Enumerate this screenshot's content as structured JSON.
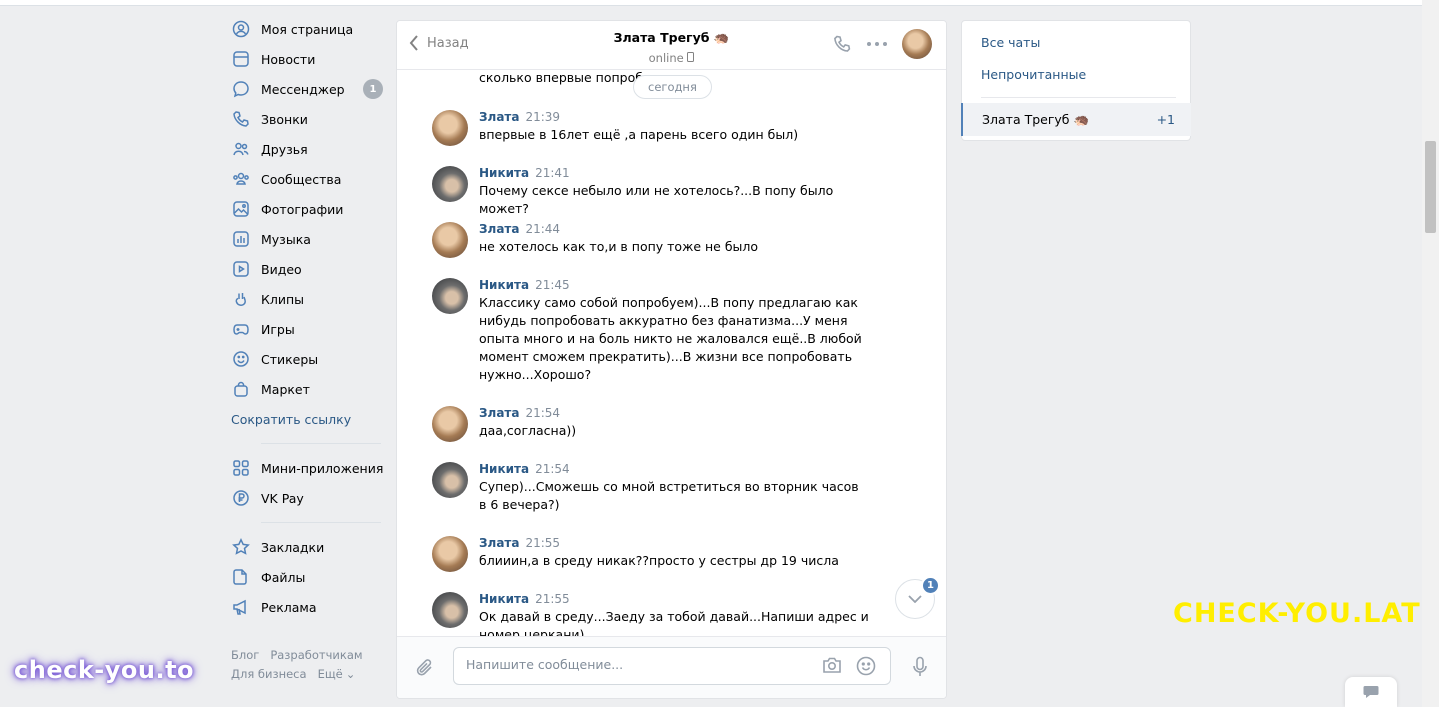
{
  "nav": {
    "items": [
      {
        "label": "Моя страница",
        "icon": "user-circle-icon"
      },
      {
        "label": "Новости",
        "icon": "news-icon"
      },
      {
        "label": "Мессенджер",
        "icon": "message-icon",
        "count": "1"
      },
      {
        "label": "Звонки",
        "icon": "phone-icon"
      },
      {
        "label": "Друзья",
        "icon": "friends-icon"
      },
      {
        "label": "Сообщества",
        "icon": "communities-icon"
      },
      {
        "label": "Фотографии",
        "icon": "photos-icon"
      },
      {
        "label": "Музыка",
        "icon": "music-icon"
      },
      {
        "label": "Видео",
        "icon": "video-icon"
      },
      {
        "label": "Клипы",
        "icon": "clips-icon"
      },
      {
        "label": "Игры",
        "icon": "games-icon"
      },
      {
        "label": "Стикеры",
        "icon": "stickers-icon"
      },
      {
        "label": "Маркет",
        "icon": "market-icon"
      }
    ],
    "shorten_link": "Сократить ссылку",
    "apps": [
      {
        "label": "Мини-приложения",
        "icon": "mini-apps-icon"
      },
      {
        "label": "VK Pay",
        "icon": "vkpay-icon"
      }
    ],
    "extra": [
      {
        "label": "Закладки",
        "icon": "bookmark-icon"
      },
      {
        "label": "Файлы",
        "icon": "files-icon"
      },
      {
        "label": "Реклама",
        "icon": "ads-icon"
      }
    ]
  },
  "footer": {
    "blog": "Блог",
    "developers": "Разработчикам",
    "business": "Для бизнеса",
    "more": "Ещё"
  },
  "chat": {
    "back_label": "Назад",
    "peer_name": "Злата Трегуб",
    "peer_status": "online",
    "date_pill": "сегодня",
    "partial_text": "сколько впервые попробо",
    "messages": [
      {
        "author": "Злата",
        "time": "21:39",
        "text": "впервые в 16лет ещё ,а парень всего один был)"
      },
      {
        "author": "Никита",
        "time": "21:41",
        "text": "Почему сексе небыло или не хотелось?...В попу было может?"
      },
      {
        "author": "Злата",
        "time": "21:44",
        "text": "не хотелось как то,и в попу тоже не было"
      },
      {
        "author": "Никита",
        "time": "21:45",
        "text": "Классику само собой попробуем)...В попу предлагаю как нибудь попробовать аккуратно без фанатизма...У меня опыта много и на боль никто не жаловался ещё..В любой момент сможем прекратить)...В жизни все попробовать нужно...Хорошо?"
      },
      {
        "author": "Злата",
        "time": "21:54",
        "text": "даа,согласна))"
      },
      {
        "author": "Никита",
        "time": "21:54",
        "text": "Супер)...Сможешь со мной встретиться во вторник часов в 6 вечера?)"
      },
      {
        "author": "Злата",
        "time": "21:55",
        "text": "блииин,а в среду никак??просто у сестры др 19 числа"
      },
      {
        "author": "Никита",
        "time": "21:55",
        "text": "Ок давай в среду...Заеду за тобой давай...Напиши адрес и номер церкани)"
      }
    ],
    "unread_badge": "1",
    "composer_placeholder": "Напишите сообщение..."
  },
  "right": {
    "all_chats": "Все чаты",
    "unread": "Непрочитанные",
    "active_chat": "Злата Трегуб",
    "active_count": "+1"
  },
  "watermarks": {
    "left": "check-you.to",
    "right": "CHECK-YOU.LAT"
  },
  "colors": {
    "accent": "#2a5885",
    "badge": "#5181b8",
    "background": "#edeef0",
    "watermark_yellow": "#ffee00"
  }
}
